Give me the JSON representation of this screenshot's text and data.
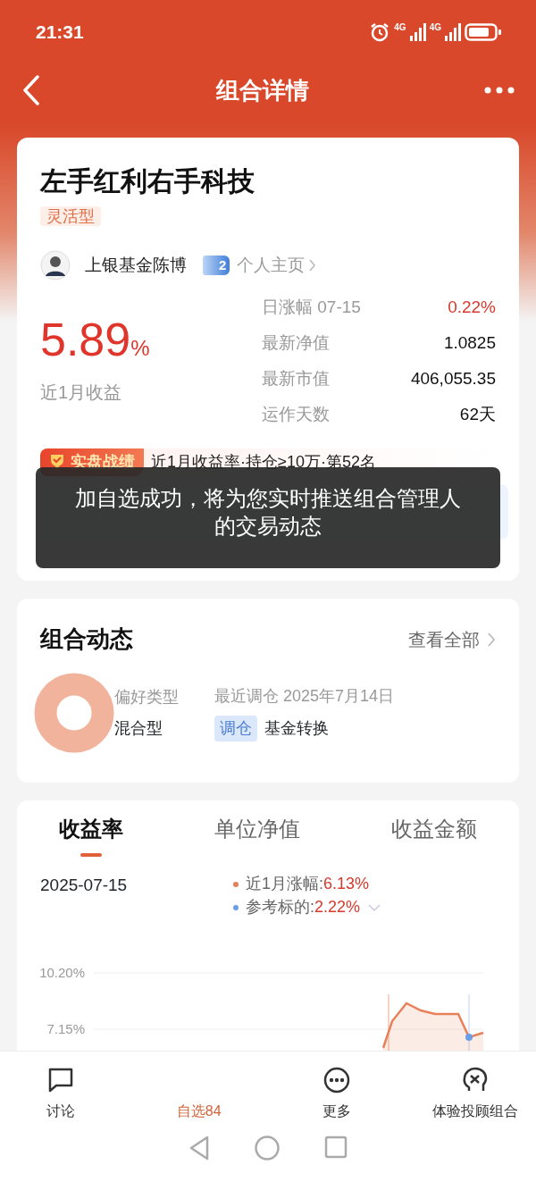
{
  "status_bar": {
    "time": "21:31",
    "network_1": "4G",
    "network_2": "4G"
  },
  "header": {
    "title": "组合详情"
  },
  "portfolio": {
    "name": "左手红利右手科技",
    "tag": "灵活型",
    "manager": {
      "name": "上银基金陈博",
      "level": "2",
      "profile_link": "个人主页"
    },
    "return": {
      "value": "5.89",
      "unit": "%",
      "label": "近1月收益"
    },
    "stats": [
      {
        "label": "日涨幅 07-15",
        "value": "0.22%",
        "kind": "change"
      },
      {
        "label": "最新净值",
        "value": "1.0825",
        "kind": "plain"
      },
      {
        "label": "最新市值",
        "value": "406,055.35",
        "kind": "plain"
      },
      {
        "label": "运作天数",
        "value": "62天",
        "kind": "plain"
      }
    ],
    "ranking": {
      "badge": "实盘战绩",
      "text": "近1月收益率·持仓≥10万·第52名"
    }
  },
  "toast": {
    "text": "加自选成功，将为您实时推送组合管理人的交易动态"
  },
  "dynamics": {
    "title": "组合动态",
    "link": "查看全部",
    "preference_label": "偏好类型",
    "preference_value": "混合型",
    "latest_label": "最近调仓 2025年7月14日",
    "latest_tag": "调仓",
    "latest_text": "基金转换"
  },
  "performance": {
    "tabs": [
      {
        "label": "收益率",
        "selected": true
      },
      {
        "label": "单位净值",
        "selected": false
      },
      {
        "label": "收益金额",
        "selected": false
      }
    ],
    "date": "2025-07-15",
    "legend": [
      {
        "label": "近1月涨幅:",
        "value": "6.13%",
        "color": "#e8805a",
        "dropdown": false
      },
      {
        "label": "参考标的:",
        "value": "2.22%",
        "color": "#6a9ee8",
        "dropdown": true
      }
    ],
    "y_axis_labels": [
      "10.20%",
      "7.15%"
    ]
  },
  "bottom_nav": [
    {
      "label": "讨论",
      "kind": "chat",
      "selected": false
    },
    {
      "label": "自选84",
      "kind": "none",
      "selected": true
    },
    {
      "label": "更多",
      "kind": "more",
      "selected": false
    },
    {
      "label": "体验投顾组合",
      "kind": "brain",
      "selected": false
    }
  ]
}
